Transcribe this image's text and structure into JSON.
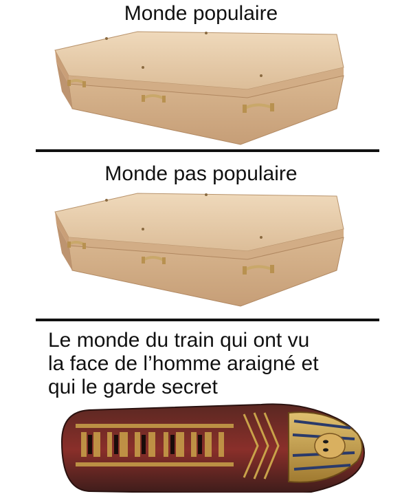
{
  "panels": [
    {
      "caption": "Monde populaire"
    },
    {
      "caption": "Monde pas populaire"
    },
    {
      "caption_lines": [
        "Le monde du train qui ont vu",
        "la face de l’homme araigné et",
        "qui le garde secret"
      ]
    }
  ],
  "colors": {
    "wood_light": "#e8cfae",
    "wood_mid": "#d8b48d",
    "wood_dark": "#b98f66",
    "handle_brass": "#c9a86a",
    "sarcophagus_dark": "#3a1c1a",
    "sarcophagus_red": "#8a2f2a",
    "sarcophagus_gold": "#c9a24a"
  }
}
